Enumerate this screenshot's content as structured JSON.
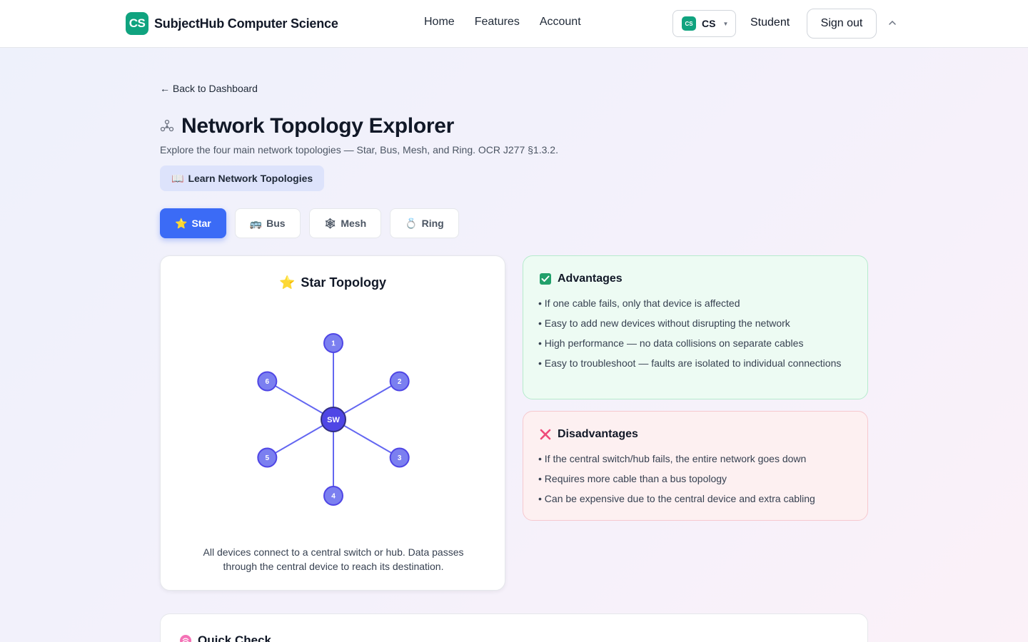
{
  "header": {
    "brand_logo": "CS",
    "brand_name": "SubjectHub Computer Science",
    "nav": [
      "Home",
      "Features",
      "Account"
    ],
    "subject_badge": "CS",
    "subject_value": "CS",
    "role": "Student",
    "signout": "Sign out"
  },
  "page": {
    "back": "← Back to Dashboard",
    "title": "Network Topology Explorer",
    "subtitle": "Explore the four main network topologies — Star, Bus, Mesh, and Ring. OCR J277 §1.3.2.",
    "learn_button": "Learn Network Topologies",
    "learn_icon": "📖"
  },
  "tabs": [
    {
      "label": "Star",
      "icon": "⭐"
    },
    {
      "label": "Bus",
      "icon": "🚌"
    },
    {
      "label": "Mesh",
      "icon": "🕸"
    },
    {
      "label": "Ring",
      "icon": "💍"
    }
  ],
  "diagram": {
    "icon": "⭐",
    "title": "Star Topology",
    "hub_label": "SW",
    "node_labels": [
      "1",
      "2",
      "3",
      "4",
      "5",
      "6"
    ],
    "description": "All devices connect to a central switch or hub. Data passes through the central device to reach its destination.",
    "colors": {
      "node": "#7b7ff0",
      "hub": "#4f46e5",
      "line": "#6366f1"
    }
  },
  "advantages": {
    "title": "Advantages",
    "items": [
      "• If one cable fails, only that device is affected",
      "• Easy to add new devices without disrupting the network",
      "• High performance — no data collisions on separate cables",
      "• Easy to troubleshoot — faults are isolated to individual connections"
    ]
  },
  "disadvantages": {
    "title": "Disadvantages",
    "items": [
      "• If the central switch/hub fails, the entire network goes down",
      "• Requires more cable than a bus topology",
      "• Can be expensive due to the central device and extra cabling"
    ]
  },
  "quick_check": {
    "title": "Quick Check"
  },
  "colors": {
    "brand": "#10a37f",
    "accent": "#3b6bf6"
  }
}
